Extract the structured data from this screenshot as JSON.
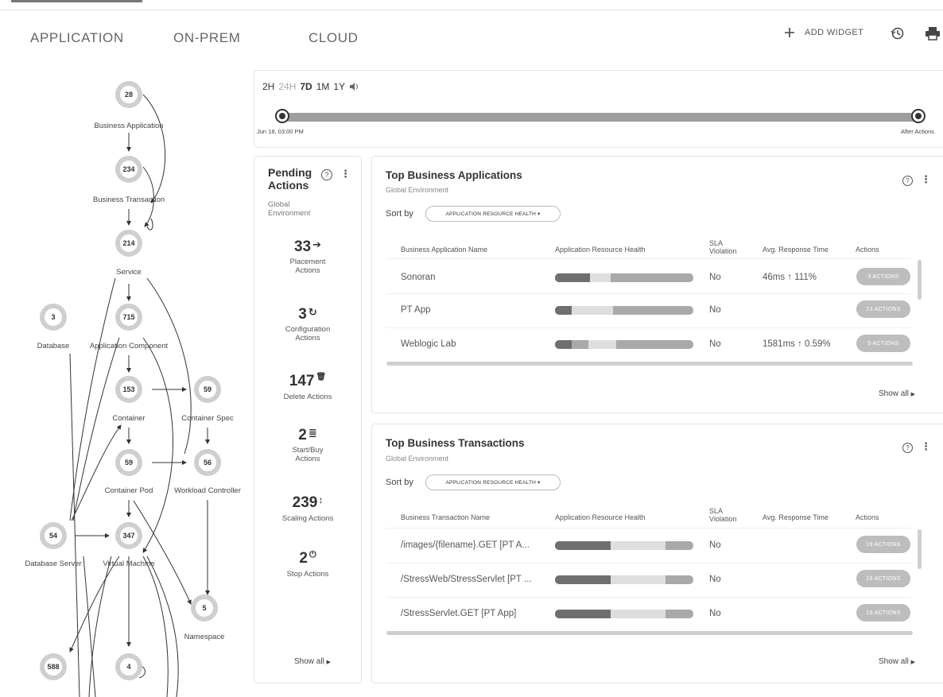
{
  "tabs": [
    {
      "label": "APPLICATION"
    },
    {
      "label": "ON-PREM"
    },
    {
      "label": "CLOUD"
    }
  ],
  "toolbar": {
    "add_widget_label": "ADD WIDGET",
    "add_widget_icon": "plus-icon",
    "history_icon": "history-icon",
    "print_icon": "print-icon"
  },
  "supply_chain": {
    "nodes": [
      {
        "count": "28",
        "label": "Business Application"
      },
      {
        "count": "234",
        "label": "Business Transaction"
      },
      {
        "count": "214",
        "label": "Service"
      },
      {
        "count": "3",
        "label": "Database"
      },
      {
        "count": "715",
        "label": "Application Component"
      },
      {
        "count": "153",
        "label": "Container"
      },
      {
        "count": "59",
        "label": "Container Spec"
      },
      {
        "count": "59",
        "label": "Container Pod"
      },
      {
        "count": "56",
        "label": "Workload Controller"
      },
      {
        "count": "54",
        "label": "Database Server"
      },
      {
        "count": "347",
        "label": "Virtual Machine"
      },
      {
        "count": "5",
        "label": "Namespace"
      },
      {
        "count": "588",
        "label": ""
      },
      {
        "count": "4",
        "label": ""
      }
    ]
  },
  "timeline": {
    "ranges": [
      "2H",
      "24H",
      "7D",
      "1M",
      "1Y"
    ],
    "active_ranges": [
      "2H",
      "7D",
      "1M",
      "1Y"
    ],
    "speaker_icon": "speaker-icon",
    "start_label": "Jun 18, 03:00 PM",
    "end_label": "After Actions"
  },
  "pending_actions": {
    "title": "Pending Actions",
    "subtitle": "Global Environment",
    "items": [
      {
        "count": "33",
        "icon": "arrow-right-icon",
        "glyph": "➔",
        "label": "Placement Actions"
      },
      {
        "count": "3",
        "icon": "refresh-icon",
        "glyph": "↻",
        "label": "Configuration Actions"
      },
      {
        "count": "147",
        "icon": "trash-icon",
        "glyph": "🗑",
        "label": "Delete Actions"
      },
      {
        "count": "2",
        "icon": "list-icon",
        "glyph": "≣",
        "label": "Start/Buy Actions"
      },
      {
        "count": "239",
        "icon": "scale-icon",
        "glyph": "↕",
        "label": "Scaling Actions"
      },
      {
        "count": "2",
        "icon": "power-icon",
        "glyph": "⏻",
        "label": "Stop Actions"
      }
    ],
    "show_all": "Show all"
  },
  "top_apps": {
    "title": "Top Business Applications",
    "subtitle": "Global Environment",
    "sort_by_label": "Sort by",
    "sort_value": "APPLICATION RESOURCE HEALTH",
    "columns": [
      "Business Application Name",
      "Application Resource Health",
      "SLA Violation",
      "Avg. Response Time",
      "Actions"
    ],
    "rows": [
      {
        "name": "Sonoran",
        "sla": "No",
        "response": "46ms ↑ 111%",
        "actions": "3 ACTIONS",
        "health": [
          0.25,
          0.15,
          0.6
        ]
      },
      {
        "name": "PT App",
        "sla": "No",
        "response": "",
        "actions": "23 ACTIONS",
        "health": [
          0.12,
          0.3,
          0.58
        ]
      },
      {
        "name": "Weblogic Lab",
        "sla": "No",
        "response": "1581ms ↑ 0.59%",
        "actions": "5 ACTIONS",
        "health": [
          0.12,
          0.12,
          0.2,
          0.56
        ]
      }
    ],
    "show_all": "Show all"
  },
  "top_txns": {
    "title": "Top Business Transactions",
    "subtitle": "Global Environment",
    "sort_by_label": "Sort by",
    "sort_value": "APPLICATION RESOURCE HEALTH",
    "columns": [
      "Business Transaction Name",
      "Application Resource Health",
      "SLA Violation",
      "Avg. Response Time",
      "Actions"
    ],
    "rows": [
      {
        "name": "/images/{filename}.GET [PT A...",
        "sla": "No",
        "response": "",
        "actions": "19 ACTIONS",
        "health": [
          0.4,
          0.4,
          0.2
        ]
      },
      {
        "name": "/StressWeb/StressServlet [PT ...",
        "sla": "No",
        "response": "",
        "actions": "19 ACTIONS",
        "health": [
          0.4,
          0.4,
          0.2
        ]
      },
      {
        "name": "/StressServlet.GET [PT App]",
        "sla": "No",
        "response": "",
        "actions": "19 ACTIONS",
        "health": [
          0.4,
          0.4,
          0.2
        ]
      }
    ],
    "show_all": "Show all"
  },
  "colors": {
    "health_dark": "#6f6f6f",
    "health_light": "#dedede",
    "health_mid": "#a9a9a9",
    "button_gray": "#bdbdbd"
  }
}
